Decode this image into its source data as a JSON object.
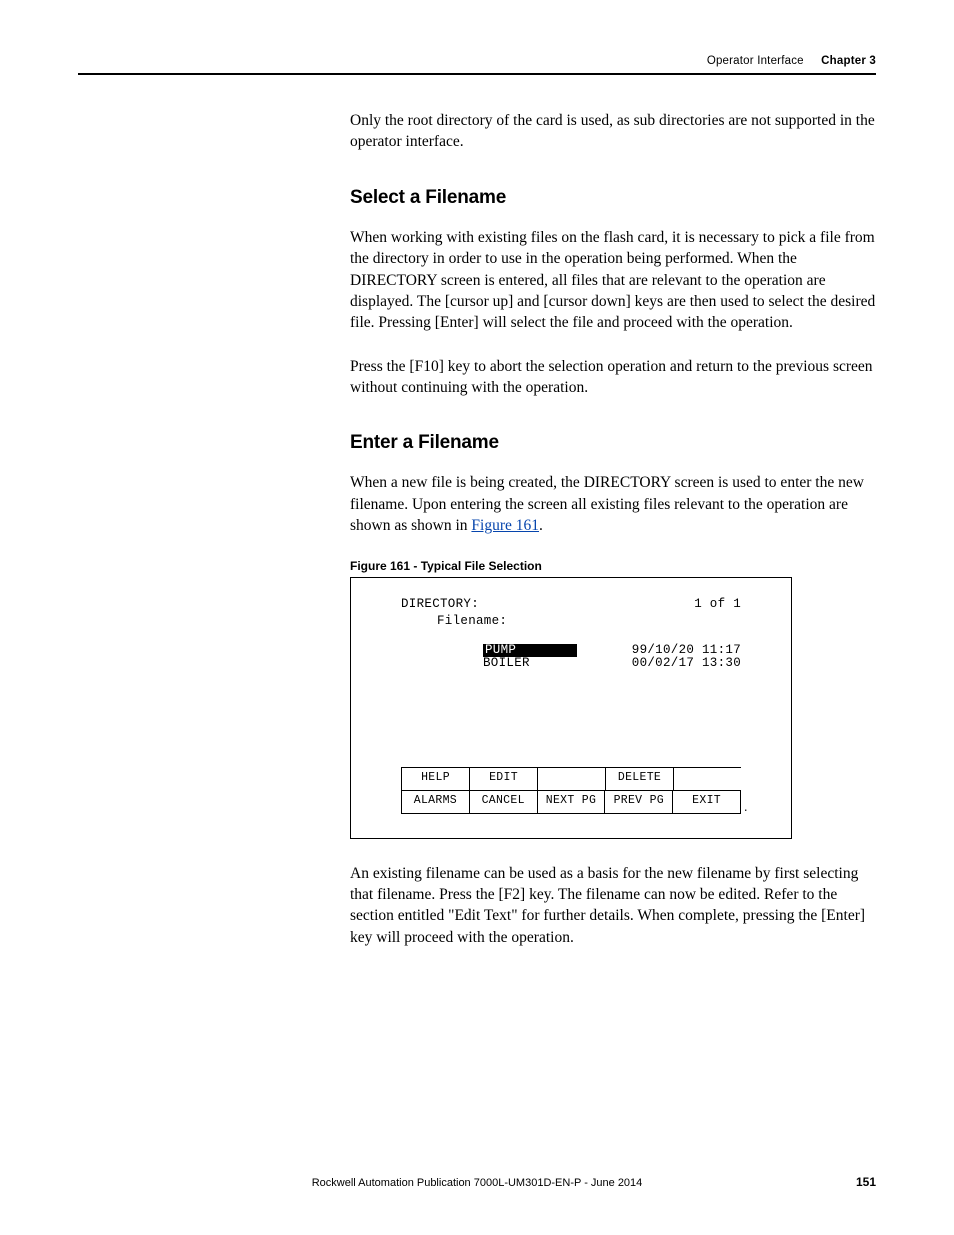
{
  "header": {
    "section": "Operator Interface",
    "chapter": "Chapter 3"
  },
  "body": {
    "p1": "Only the root directory of the card is used, as sub directories are not supported in the operator interface.",
    "h1": "Select a Filename",
    "p2": "When working with existing files on the flash card, it is necessary to pick a file from the directory in order to use in the operation being performed. When the DIRECTORY screen is entered, all files that are relevant to the operation are displayed. The [cursor up] and [cursor down] keys are then used to select the desired file. Pressing [Enter] will select the file and proceed with the operation.",
    "p3": "Press the [F10] key to abort the selection operation and return to the previous screen without continuing with the operation.",
    "h2": "Enter a Filename",
    "p4a": "When a new file is being created, the DIRECTORY screen is used to enter the new filename. Upon entering the screen all existing files relevant to the operation are shown as shown in ",
    "p4link": "Figure 161",
    "p4b": ".",
    "figcap": "Figure 161 - Typical File Selection",
    "p5": "An existing filename can be used as a basis for the new filename by first selecting that filename. Press the [F2] key. The filename can now be edited. Refer to the section entitled \"Edit Text\" for further details. When complete, pressing the [Enter] key will proceed with the operation."
  },
  "figure": {
    "dir_label": "DIRECTORY:",
    "page_ind": "1 of  1",
    "fn_label": "Filename:",
    "files": [
      {
        "name": "PUMP",
        "date": "99/10/20 11:17",
        "selected": true
      },
      {
        "name": "BOILER",
        "date": "00/02/17 13:30",
        "selected": false
      }
    ],
    "softkeys_top": [
      "HELP",
      "EDIT",
      "",
      "DELETE",
      ""
    ],
    "softkeys_bot": [
      "ALARMS",
      "CANCEL",
      "NEXT PG",
      "PREV PG",
      "EXIT"
    ]
  },
  "footer": {
    "pub": "Rockwell Automation Publication 7000L-UM301D-EN-P - June 2014",
    "page": "151"
  }
}
